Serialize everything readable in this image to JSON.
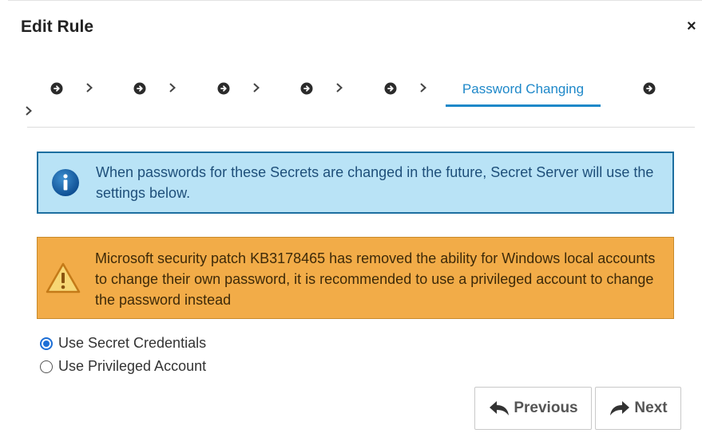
{
  "dialog": {
    "title": "Edit Rule",
    "close_label": "×"
  },
  "wizard": {
    "active_step_label": "Password Changing"
  },
  "alerts": {
    "info_text": "When passwords for these Secrets are changed in the future, Secret Server will use the settings below.",
    "warning_text": "Microsoft security patch KB3178465 has removed the ability for Windows local accounts to change their own password, it is recommended to use a privileged account to change the password instead"
  },
  "options": [
    {
      "label": "Use Secret Credentials",
      "selected": true
    },
    {
      "label": "Use Privileged Account",
      "selected": false
    }
  ],
  "buttons": {
    "previous_label": "Previous",
    "next_label": "Next"
  },
  "colors": {
    "accent": "#1e88c9",
    "info_bg": "#b9e3f6",
    "warning_bg": "#f2ac48"
  }
}
